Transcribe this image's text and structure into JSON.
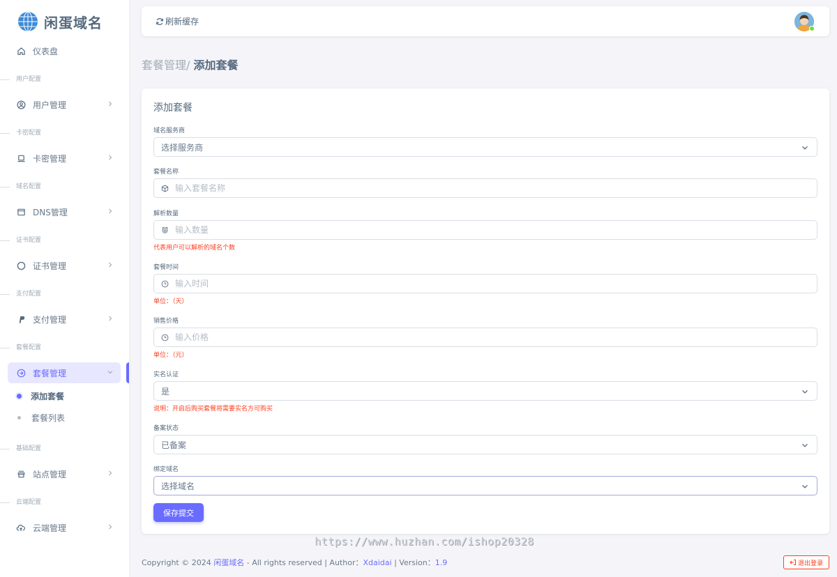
{
  "brand": {
    "name": "闲蛋域名",
    "logo_icon": "globe-icon"
  },
  "navbar": {
    "refresh_label": "刷新缓存"
  },
  "sidebar": {
    "dashboard": "仪表盘",
    "sections": [
      {
        "header": "用户配置",
        "item": "用户管理",
        "icon": "user-circle-icon"
      },
      {
        "header": "卡密配置",
        "item": "卡密管理",
        "icon": "laptop-icon"
      },
      {
        "header": "域名配置",
        "item": "DNS管理",
        "icon": "window-icon"
      },
      {
        "header": "证书配置",
        "item": "证书管理",
        "icon": "circle-icon"
      },
      {
        "header": "支付配置",
        "item": "支付管理",
        "icon": "paypal-icon"
      },
      {
        "header": "套餐配置",
        "item": "套餐管理",
        "icon": "package-icon"
      },
      {
        "header": "基础配置",
        "item": "站点管理",
        "icon": "store-icon"
      },
      {
        "header": "云端配置",
        "item": "云端管理",
        "icon": "cloud-upload-icon"
      }
    ],
    "subitems": [
      "添加套餐",
      "套餐列表"
    ]
  },
  "breadcrumb": {
    "parent": "套餐管理/",
    "current": "添加套餐"
  },
  "form": {
    "title": "添加套餐",
    "provider": {
      "label": "域名服务商",
      "value": "选择服务商"
    },
    "name": {
      "label": "套餐名称",
      "placeholder": "输入套餐名称"
    },
    "count": {
      "label": "解析数量",
      "placeholder": "输入数量",
      "hint": "代表用户可以解析的域名个数"
    },
    "duration": {
      "label": "套餐时间",
      "placeholder": "输入时间",
      "hint": "单位：（天）"
    },
    "price": {
      "label": "销售价格",
      "placeholder": "输入价格",
      "hint": "单位：（元）"
    },
    "realname": {
      "label": "实名认证",
      "value": "是",
      "hint": "说明：开启后购买套餐将需要实名方可购买"
    },
    "filing": {
      "label": "备案状态",
      "value": "已备案"
    },
    "bind_domain": {
      "label": "绑定域名",
      "value": "选择域名"
    },
    "submit_label": "保存提交"
  },
  "watermark": "https://www.huzhan.com/ishop20328",
  "footer": {
    "copyright": "Copyright © 2024 ",
    "site": "闲蛋域名",
    "rights": " - All rights reserved | Author：",
    "author": "Xdaidai",
    "version_label": " | Version：",
    "version": "1.9"
  },
  "logout_label": "退出登录",
  "colors": {
    "primary": "#696cff",
    "danger": "#ff3e1d",
    "text": "#566a7f",
    "bg": "#f5f5f9"
  }
}
